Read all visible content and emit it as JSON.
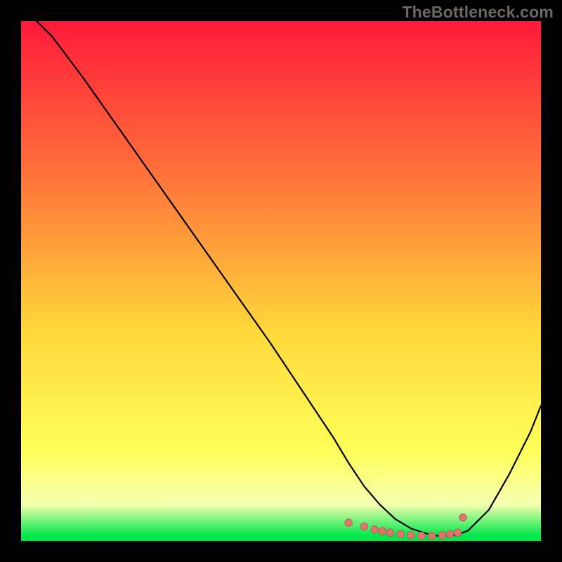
{
  "watermark": "TheBottleneck.com",
  "colors": {
    "background": "#000000",
    "gradient_top": "#ff1a3a",
    "gradient_mid1": "#ff7a3a",
    "gradient_mid2": "#ffd93a",
    "gradient_yellow": "#ffff5a",
    "gradient_pale": "#f5ffb0",
    "gradient_green": "#00e84a",
    "curve": "#000000",
    "marker_fill": "#dd766f",
    "marker_stroke": "#c85a54"
  },
  "chart_data": {
    "type": "line",
    "title": "",
    "xlabel": "",
    "ylabel": "",
    "xlim": [
      0,
      100
    ],
    "ylim": [
      0,
      100
    ],
    "x": [
      0,
      6,
      12,
      18,
      24,
      30,
      36,
      42,
      48,
      54,
      60,
      63,
      66,
      69,
      72,
      75,
      78,
      80,
      82,
      84,
      86,
      90,
      94,
      98,
      100
    ],
    "y": [
      103,
      97,
      89,
      80.5,
      72,
      63.5,
      55,
      46.5,
      38,
      29,
      20,
      15,
      10.5,
      7,
      4.2,
      2.4,
      1.4,
      1,
      1,
      1.2,
      2,
      6,
      13,
      21,
      26
    ],
    "markers": {
      "x": [
        63,
        66,
        68,
        69.5,
        71,
        73,
        75,
        77,
        79,
        81,
        82.5,
        84,
        85
      ],
      "y": [
        3.5,
        2.8,
        2.2,
        1.9,
        1.6,
        1.3,
        1.1,
        1.0,
        1.0,
        1.1,
        1.3,
        1.6,
        4.5
      ]
    }
  }
}
